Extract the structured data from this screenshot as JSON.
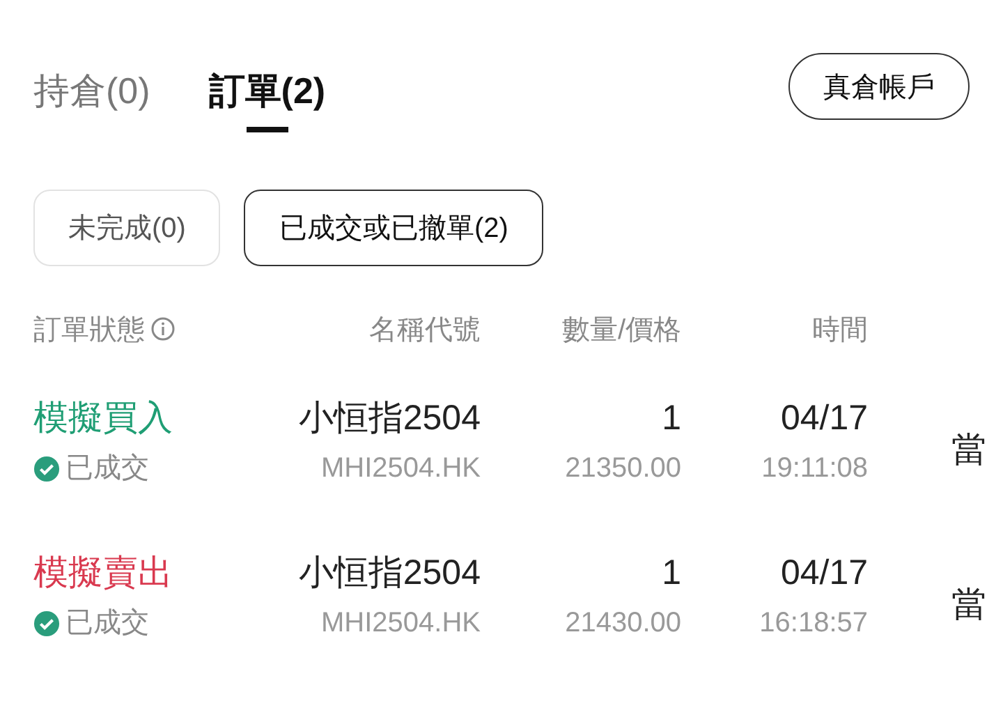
{
  "tabs": [
    {
      "label": "持倉(0)",
      "selected": false
    },
    {
      "label": "訂單(2)",
      "selected": true
    }
  ],
  "account_button": "真倉帳戶",
  "filters": [
    {
      "label": "未完成(0)",
      "selected": false
    },
    {
      "label": "已成交或已撤單(2)",
      "selected": true
    }
  ],
  "columns": [
    "訂單狀態",
    "名稱代號",
    "數量/價格",
    "時間"
  ],
  "orders": [
    {
      "kind": "buy",
      "action": "模擬買入",
      "status": "已成交",
      "name": "小恒指2504",
      "code": "MHI2504.HK",
      "quantity": "1",
      "price": "21350.00",
      "date": "04/17",
      "time": "19:11:08",
      "column_5": "當"
    },
    {
      "kind": "sell",
      "action": "模擬賣出",
      "status": "已成交",
      "name": "小恒指2504",
      "code": "MHI2504.HK",
      "quantity": "1",
      "price": "21430.00",
      "date": "04/17",
      "time": "16:18:57",
      "column_5": "當"
    }
  ]
}
